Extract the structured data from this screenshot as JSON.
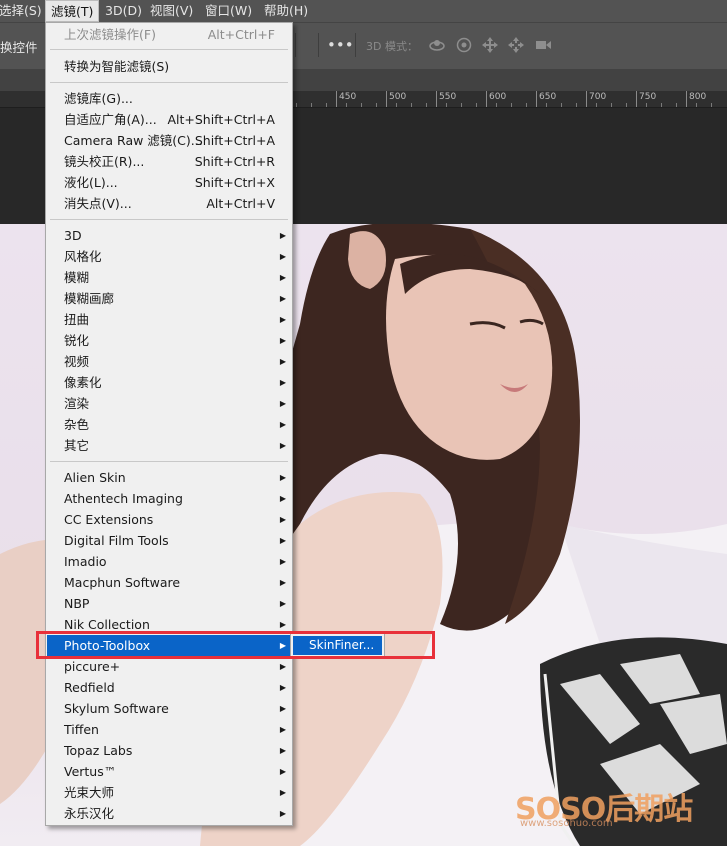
{
  "menubar": {
    "items": [
      {
        "label": "选择(S)"
      },
      {
        "label": "滤镜(T)"
      },
      {
        "label": "3D(D)"
      },
      {
        "label": "视图(V)"
      },
      {
        "label": "窗口(W)"
      },
      {
        "label": "帮助(H)"
      }
    ]
  },
  "options_bar": {
    "left_label": "换控件",
    "more": "•••",
    "mode_label": "3D 模式：",
    "icons_3d": [
      "orbit-icon",
      "roll-icon",
      "pan-icon",
      "slide-icon",
      "scale-icon"
    ]
  },
  "ruler": {
    "labels": [
      "450",
      "500",
      "550",
      "600",
      "650",
      "700",
      "750",
      "800"
    ]
  },
  "filter_menu": {
    "items": [
      {
        "label": "上次滤镜操作(F)",
        "shortcut": "Alt+Ctrl+F",
        "disabled": true
      },
      {
        "label": "转换为智能滤镜(S)",
        "shortcut": ""
      },
      {
        "label": "滤镜库(G)...",
        "shortcut": ""
      },
      {
        "label": "自适应广角(A)...",
        "shortcut": "Alt+Shift+Ctrl+A"
      },
      {
        "label": "Camera Raw 滤镜(C)...",
        "shortcut": "Shift+Ctrl+A"
      },
      {
        "label": "镜头校正(R)...",
        "shortcut": "Shift+Ctrl+R"
      },
      {
        "label": "液化(L)...",
        "shortcut": "Shift+Ctrl+X"
      },
      {
        "label": "消失点(V)...",
        "shortcut": "Alt+Ctrl+V"
      },
      {
        "label": "3D",
        "submenu": true
      },
      {
        "label": "风格化",
        "submenu": true
      },
      {
        "label": "模糊",
        "submenu": true
      },
      {
        "label": "模糊画廊",
        "submenu": true
      },
      {
        "label": "扭曲",
        "submenu": true
      },
      {
        "label": "锐化",
        "submenu": true
      },
      {
        "label": "视频",
        "submenu": true
      },
      {
        "label": "像素化",
        "submenu": true
      },
      {
        "label": "渲染",
        "submenu": true
      },
      {
        "label": "杂色",
        "submenu": true
      },
      {
        "label": "其它",
        "submenu": true
      },
      {
        "label": "Alien Skin",
        "submenu": true
      },
      {
        "label": "Athentech Imaging",
        "submenu": true
      },
      {
        "label": "CC Extensions",
        "submenu": true
      },
      {
        "label": "Digital Film Tools",
        "submenu": true
      },
      {
        "label": "Imadio",
        "submenu": true
      },
      {
        "label": "Macphun Software",
        "submenu": true
      },
      {
        "label": "NBP",
        "submenu": true
      },
      {
        "label": "Nik Collection",
        "submenu": true
      },
      {
        "label": "Photo-Toolbox",
        "submenu": true,
        "highlighted": true
      },
      {
        "label": "piccure+",
        "submenu": true
      },
      {
        "label": "Redfield",
        "submenu": true
      },
      {
        "label": "Skylum Software",
        "submenu": true
      },
      {
        "label": "Tiffen",
        "submenu": true
      },
      {
        "label": "Topaz Labs",
        "submenu": true
      },
      {
        "label": "Vertus™",
        "submenu": true
      },
      {
        "label": "光束大师",
        "submenu": true
      },
      {
        "label": "永乐汉化",
        "submenu": true
      }
    ]
  },
  "submenu": {
    "item": "SkinFiner..."
  },
  "highlight_color": "#0a64c8",
  "annotation_color": "#e8303a",
  "watermark": {
    "brand": "SOSO后期站",
    "url": "www.sosohuo.com"
  }
}
